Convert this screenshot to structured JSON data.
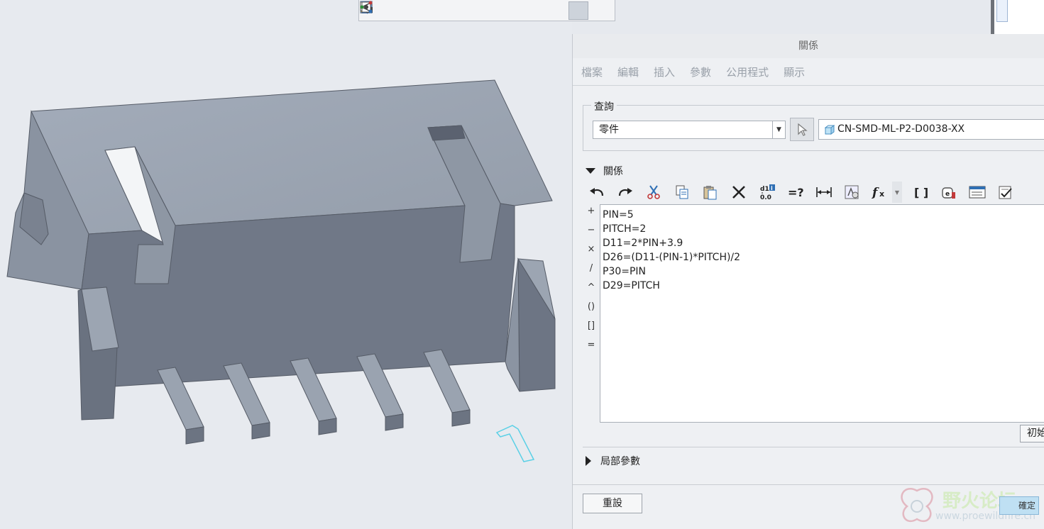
{
  "dialog": {
    "title": "關係",
    "menus": [
      "檔案",
      "編輯",
      "插入",
      "參數",
      "公用程式",
      "顯示"
    ]
  },
  "query": {
    "label": "查詢",
    "type_value": "零件",
    "model_name": "CN-SMD-ML-P2-D0038-XX"
  },
  "relations": {
    "label": "關係",
    "operators": [
      "+",
      "−",
      "×",
      "/",
      "^",
      "()",
      "[]",
      "="
    ],
    "lines": [
      "PIN=5",
      "PITCH=2",
      "D11=2*PIN+3.9",
      "D26=(D11-(PIN-1)*PITCH)/2",
      "P30=PIN",
      "D29=PITCH"
    ],
    "init_button": "初始"
  },
  "local_params": {
    "label": "局部參數"
  },
  "buttons": {
    "reset": "重設",
    "ok": "確定"
  },
  "watermark": {
    "text": "野火论坛",
    "url": "www.proewildfire.cn"
  },
  "icons": {
    "top_toolbar": [
      "zoom-fit-icon",
      "zoom-in-icon",
      "zoom-out-icon",
      "repaint-icon",
      "display-style-icon",
      "saved-view-icon",
      "view-manager-icon",
      "annotation-display-icon",
      "datum-display-icon",
      "spin-center-icon",
      "appearance-icon"
    ]
  }
}
